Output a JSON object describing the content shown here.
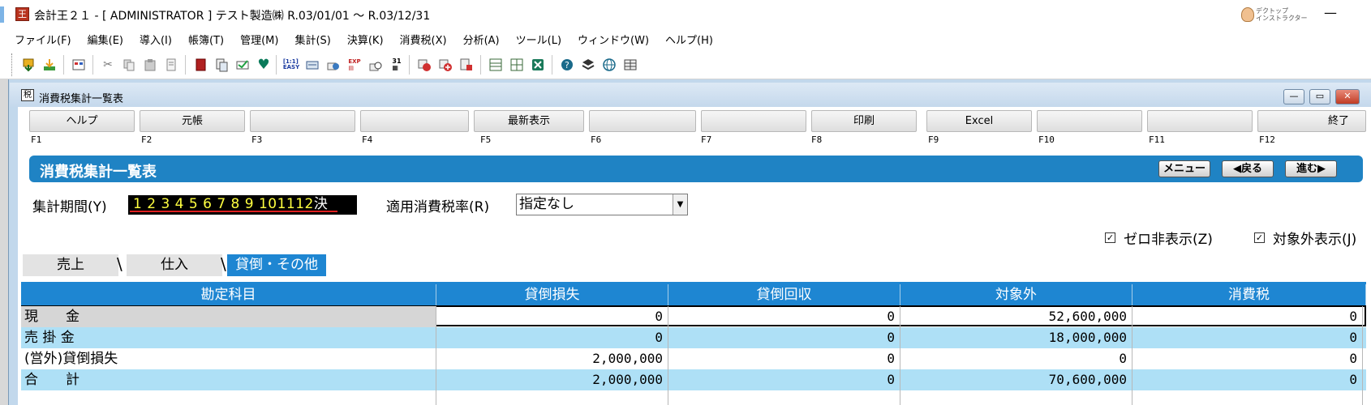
{
  "app": {
    "icon_glyph": "王",
    "title": "会計王２１ - [ ADMINISTRATOR ] テスト製造㈱ R.03/01/01 ～ R.03/12/31",
    "brand_line1": "デクトップ",
    "brand_line2": "インストラクター",
    "minimize_glyph": "—"
  },
  "menu": [
    "ファイル(F)",
    "編集(E)",
    "導入(I)",
    "帳簿(T)",
    "管理(M)",
    "集計(S)",
    "決算(K)",
    "消費税(X)",
    "分析(A)",
    "ツール(L)",
    "ウィンドウ(W)",
    "ヘルプ(H)"
  ],
  "toolbar_icons": [
    "import-icon",
    "download-icon",
    "journal-icon",
    "cut-icon",
    "copy-icon",
    "paste-icon",
    "memo-icon",
    "ledger-book-icon",
    "document-icon",
    "check-mail-icon",
    "heart-icon",
    "easy-icon",
    "card-icon",
    "money-icon",
    "export-icon",
    "calc-icon",
    "calendar-icon",
    "tax-icon",
    "tax-add-icon",
    "tax-report-icon",
    "table-icon",
    "table2-icon",
    "excel-icon",
    "help-icon",
    "layers-icon",
    "globe-icon",
    "grid-icon"
  ],
  "child_window": {
    "icon_glyph": "税",
    "title": "消費税集計一覧表"
  },
  "function_keys": [
    {
      "label": "ヘルプ",
      "key": "F1"
    },
    {
      "label": "元帳",
      "key": "F2"
    },
    {
      "label": "",
      "key": "F3"
    },
    {
      "label": "",
      "key": "F4"
    },
    {
      "label": "最新表示",
      "key": "F5"
    },
    {
      "label": "",
      "key": "F6"
    },
    {
      "label": "",
      "key": "F7"
    },
    {
      "label": "印刷",
      "key": "F8"
    },
    {
      "label": "Excel",
      "key": "F9"
    },
    {
      "label": "",
      "key": "F10"
    },
    {
      "label": "",
      "key": "F11"
    },
    {
      "label": "終了",
      "key": "F12"
    }
  ],
  "header": {
    "title": "消費税集計一覧表",
    "menu_button": "メニュー",
    "back_button": "◀戻る",
    "forward_button": "進む▶"
  },
  "filters": {
    "period_label": "集計期間(Y)",
    "period_months": "1 2 3 4 5 6 7 8 9 101112",
    "period_closing": "決",
    "tax_rate_label": "適用消費税率(R)",
    "tax_rate_value": "指定なし",
    "zero_hide_label": "ゼロ非表示(Z)",
    "zero_hide_checked": true,
    "exempt_show_label": "対象外表示(J)",
    "exempt_show_checked": true
  },
  "tabs": [
    {
      "label": "売上",
      "active": false
    },
    {
      "label": "仕入",
      "active": false
    },
    {
      "label": "貸倒・その他",
      "active": true
    }
  ],
  "table": {
    "columns": [
      "勘定科目",
      "貸倒損失",
      "貸倒回収",
      "対象外",
      "消費税"
    ],
    "rows": [
      {
        "account": "現　　金",
        "bad_debt_loss": "0",
        "bad_debt_recovery": "0",
        "exempt": "52,600,000",
        "tax": "0"
      },
      {
        "account": "売 掛 金",
        "bad_debt_loss": "0",
        "bad_debt_recovery": "0",
        "exempt": "18,000,000",
        "tax": "0"
      },
      {
        "account": "(営外)貸倒損失",
        "bad_debt_loss": "2,000,000",
        "bad_debt_recovery": "0",
        "exempt": "0",
        "tax": "0"
      },
      {
        "account": "合　　計",
        "bad_debt_loss": "2,000,000",
        "bad_debt_recovery": "0",
        "exempt": "70,600,000",
        "tax": "0"
      }
    ]
  },
  "colors": {
    "header_blue": "#1f83c4",
    "table_head": "#1e86d2",
    "row_alt": "#aee0f6",
    "period_text": "#ffff40"
  }
}
